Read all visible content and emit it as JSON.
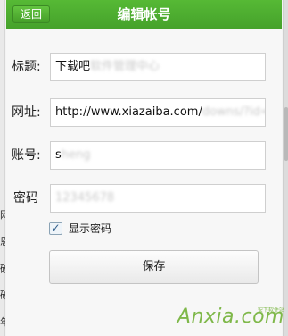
{
  "header": {
    "back_label": "返回",
    "title": "编辑帐号"
  },
  "form": {
    "title_label": "标题:",
    "title_value": "下载吧",
    "title_value_obscured": "软件管理中心",
    "url_label": "网址:",
    "url_value": "http://www.xiazaiba.com/",
    "url_value_obscured": "downs/?id=abc",
    "account_label": "账号:",
    "account_value": "s",
    "account_value_obscured": "heng",
    "password_label": "密码",
    "password_value_obscured": "12345678",
    "show_password_label": "显示密码",
    "show_password_checked": true
  },
  "actions": {
    "save_label": "保存"
  },
  "background": {
    "left_glyphs": [
      "网",
      "恩",
      "破",
      "破",
      "年"
    ]
  },
  "watermark": {
    "brand": "Anxia.com",
    "sub": "安下软件站"
  },
  "colors": {
    "header_green": "#4aaa2c",
    "watermark_green": "#7fb84a"
  }
}
